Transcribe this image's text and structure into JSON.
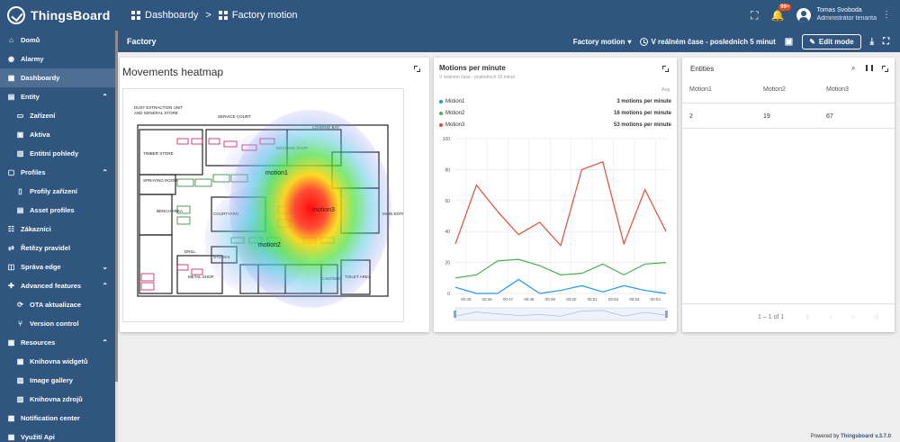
{
  "app": {
    "name": "ThingsBoard"
  },
  "breadcrumb": {
    "dashboards": "Dashboardy",
    "separator": ">",
    "current": "Factory motion"
  },
  "topbar": {
    "notification_badge": "99+",
    "user_name": "Tomas Svoboda",
    "user_role": "Administrátor tenanta"
  },
  "sidebar": {
    "items": [
      {
        "label": "Domů",
        "icon": "home-icon"
      },
      {
        "label": "Alarmy",
        "icon": "alarm-icon"
      },
      {
        "label": "Dashboardy",
        "icon": "dashboard-icon",
        "active": true
      },
      {
        "label": "Entity",
        "icon": "entity-icon",
        "expanded": true
      },
      {
        "label": "Zařízení",
        "icon": "device-icon",
        "sub": true
      },
      {
        "label": "Aktiva",
        "icon": "asset-icon",
        "sub": true
      },
      {
        "label": "Entitní pohledy",
        "icon": "view-icon",
        "sub": true
      },
      {
        "label": "Profiles",
        "icon": "profile-icon",
        "expanded": true
      },
      {
        "label": "Profily zařízení",
        "icon": "device-profile-icon",
        "sub": true
      },
      {
        "label": "Asset profiles",
        "icon": "asset-profile-icon",
        "sub": true
      },
      {
        "label": "Zákazníci",
        "icon": "customers-icon"
      },
      {
        "label": "Řetězy pravidel",
        "icon": "rule-chain-icon"
      },
      {
        "label": "Správa edge",
        "icon": "edge-icon",
        "expanded": false
      },
      {
        "label": "Advanced features",
        "icon": "advanced-icon",
        "expanded": true
      },
      {
        "label": "OTA aktualizace",
        "icon": "ota-icon",
        "sub": true
      },
      {
        "label": "Version control",
        "icon": "version-icon",
        "sub": true
      },
      {
        "label": "Resources",
        "icon": "resources-icon",
        "expanded": true
      },
      {
        "label": "Knihovna widgetů",
        "icon": "widget-library-icon",
        "sub": true
      },
      {
        "label": "Image gallery",
        "icon": "image-icon",
        "sub": true
      },
      {
        "label": "Knihovna zdrojů",
        "icon": "resource-library-icon",
        "sub": true
      },
      {
        "label": "Notification center",
        "icon": "notification-icon"
      },
      {
        "label": "Využití Api",
        "icon": "api-icon"
      }
    ]
  },
  "toolbar": {
    "title": "Factory",
    "state": "Factory motion",
    "timewindow": "V reálném čase - posledních 5 minut",
    "edit_label": "Edit mode"
  },
  "heatmap": {
    "title": "Movements heatmap",
    "floorplan_labels": [
      "DUST EXTRACTION UNIT AND GENERAL STORE",
      "SERVICE COURT",
      "LOADING BAY",
      "TIMBER STORE",
      "SPRAYING ROOM",
      "BENCH AREA",
      "COURTYARD",
      "MACHINE SHOP",
      "DRILL",
      "METAL SHOP",
      "STORES",
      "TOILET AREA",
      "CANTEEN",
      "MAIN ENTRANCE",
      "motion1",
      "motion2",
      "motion3"
    ]
  },
  "motions_chart": {
    "title": "Motions per minute",
    "subtitle": "V reálném čase - posledních 10 minut",
    "avg_label": "Avg",
    "legend": [
      {
        "name": "Motion1",
        "value": "3 motions per minute",
        "color": "#2196f3"
      },
      {
        "name": "Motion2",
        "value": "16 motions per minute",
        "color": "#4caf50"
      },
      {
        "name": "Motion3",
        "value": "53 motions per minute",
        "color": "#e04e3a"
      }
    ]
  },
  "chart_data": {
    "type": "line",
    "x": [
      "00:45",
      "00:46",
      "00:47",
      "00:48",
      "00:49",
      "00:50",
      "00:51",
      "00:52",
      "00:53",
      "00:54"
    ],
    "ylim": [
      0,
      100
    ],
    "yticks": [
      0,
      20,
      40,
      60,
      80,
      100
    ],
    "grid": true,
    "series": [
      {
        "name": "Motion1",
        "color": "#2196f3",
        "values": [
          4,
          0,
          0,
          9,
          0,
          2,
          5,
          1,
          5,
          2,
          0
        ]
      },
      {
        "name": "Motion2",
        "color": "#4caf50",
        "values": [
          10,
          12,
          21,
          22,
          18,
          12,
          13,
          19,
          12,
          19,
          20
        ]
      },
      {
        "name": "Motion3",
        "color": "#e04e3a",
        "values": [
          32,
          70,
          53,
          38,
          46,
          31,
          80,
          85,
          32,
          67,
          40
        ]
      }
    ]
  },
  "entities_table": {
    "title": "Entities",
    "columns": [
      "Motion1",
      "Motion2",
      "Motion3"
    ],
    "rows": [
      [
        "2",
        "19",
        "67"
      ]
    ],
    "pagination": "1 – 1 of 1"
  },
  "footer": {
    "prefix": "Powered by",
    "product": "Thingsboard v.3.7.0"
  }
}
